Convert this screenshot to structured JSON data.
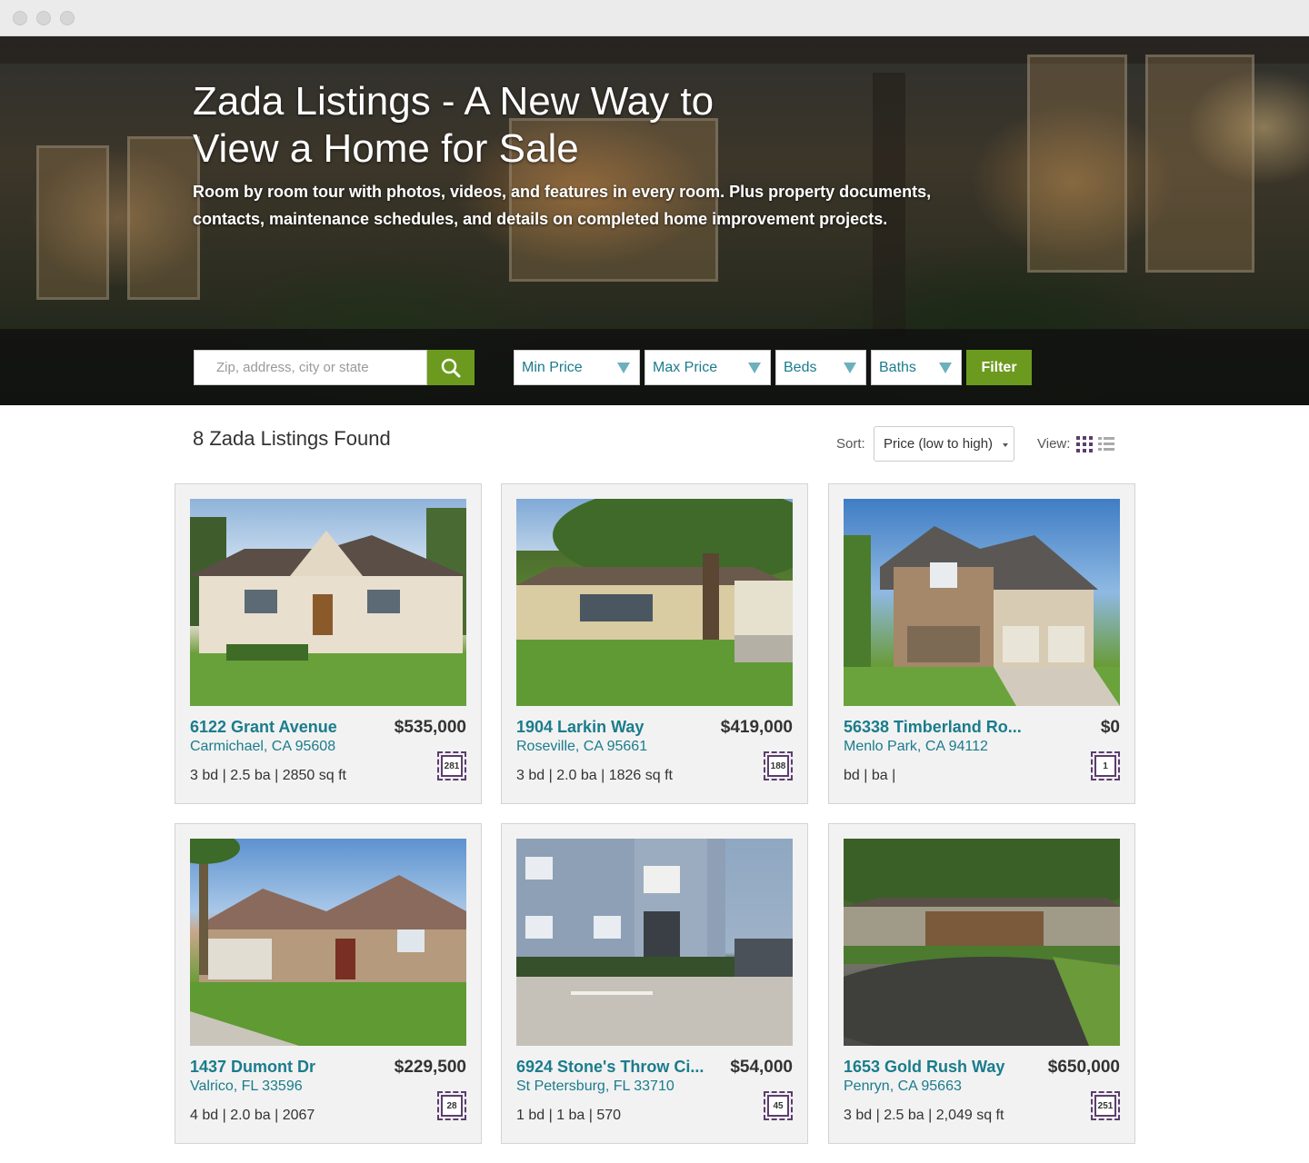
{
  "hero": {
    "title": "Zada Listings - A New Way to View a Home for Sale",
    "subtitle": "Room by room tour with photos, videos, and features in every room. Plus property documents, contacts, maintenance schedules, and details on completed home improvement projects."
  },
  "search": {
    "placeholder": "Zip, address, city or state",
    "filters": {
      "min_price": "Min Price",
      "max_price": "Max Price",
      "beds": "Beds",
      "baths": "Baths"
    },
    "filter_button": "Filter"
  },
  "results": {
    "count_text": "8 Zada Listings Found",
    "sort_label": "Sort:",
    "sort_value": "Price (low to high)",
    "view_label": "View:"
  },
  "listings": [
    {
      "address": "6122 Grant Avenue",
      "city": "Carmichael, CA 95608",
      "price": "$535,000",
      "specs": "3 bd | 2.5 ba | 2850 sq ft",
      "badge": "281"
    },
    {
      "address": "1904 Larkin Way",
      "city": "Roseville, CA 95661",
      "price": "$419,000",
      "specs": "3 bd | 2.0 ba | 1826 sq ft",
      "badge": "188"
    },
    {
      "address": "56338 Timberland Ro...",
      "city": "Menlo Park, CA 94112",
      "price": "$0",
      "specs": "bd | ba |",
      "badge": "1"
    },
    {
      "address": "1437 Dumont Dr",
      "city": "Valrico, FL 33596",
      "price": "$229,500",
      "specs": "4 bd | 2.0 ba | 2067",
      "badge": "28"
    },
    {
      "address": "6924 Stone's Throw Ci...",
      "city": "St Petersburg, FL 33710",
      "price": "$54,000",
      "specs": "1 bd | 1 ba | 570",
      "badge": "45"
    },
    {
      "address": "1653 Gold Rush Way",
      "city": "Penryn, CA 95663",
      "price": "$650,000",
      "specs": "3 bd | 2.5 ba | 2,049 sq ft",
      "badge": "251"
    }
  ],
  "colors": {
    "accent_green": "#6c9a1e",
    "link_teal": "#1a7c8c",
    "badge_purple": "#5c3d6e"
  }
}
